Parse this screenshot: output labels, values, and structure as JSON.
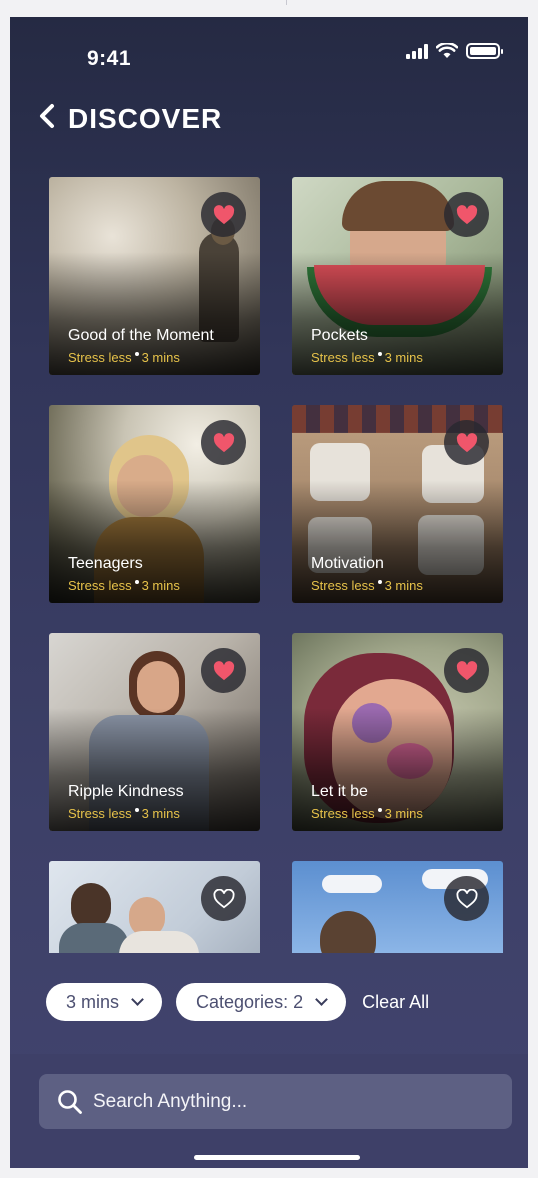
{
  "status": {
    "time": "9:41"
  },
  "header": {
    "title": "DISCOVER"
  },
  "cards": [
    {
      "title": "Good of the Moment",
      "category": "Stress less",
      "duration": "3 mins",
      "favorited": true
    },
    {
      "title": "Pockets",
      "category": "Stress less",
      "duration": "3 mins",
      "favorited": true
    },
    {
      "title": "Teenagers",
      "category": "Stress less",
      "duration": "3 mins",
      "favorited": true
    },
    {
      "title": "Motivation",
      "category": "Stress less",
      "duration": "3 mins",
      "favorited": true
    },
    {
      "title": "Ripple Kindness",
      "category": "Stress less",
      "duration": "3 mins",
      "favorited": true
    },
    {
      "title": "Let it be",
      "category": "Stress less",
      "duration": "3 mins",
      "favorited": true
    },
    {
      "title": "",
      "category": "",
      "duration": "",
      "favorited": false
    },
    {
      "title": "",
      "category": "",
      "duration": "",
      "favorited": false
    }
  ],
  "filters": {
    "duration_label": "3 mins",
    "categories_label": "Categories: 2",
    "clear_label": "Clear All"
  },
  "search": {
    "placeholder": "Search Anything..."
  },
  "colors": {
    "accent_gold": "#e6c24a",
    "heart": "#f0566b",
    "background": "#383b62"
  }
}
